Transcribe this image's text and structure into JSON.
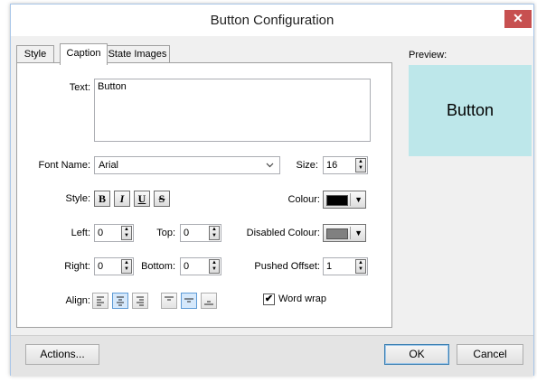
{
  "window": {
    "title": "Button Configuration",
    "close_glyph": "✕"
  },
  "tabs": [
    {
      "label": "Style",
      "active": false
    },
    {
      "label": "Caption",
      "active": true
    },
    {
      "label": "State Images",
      "active": false
    }
  ],
  "caption": {
    "text_label": "Text:",
    "text_value": "Button",
    "font_name_label": "Font Name:",
    "font_name_value": "Arial",
    "size_label": "Size:",
    "size_value": "16",
    "style_label": "Style:",
    "style_buttons": [
      "B",
      "I",
      "U",
      "S"
    ],
    "colour_label": "Colour:",
    "colour_value": "#000000",
    "disabled_colour_label": "Disabled Colour:",
    "disabled_colour_value": "#808080",
    "left_label": "Left:",
    "left_value": "0",
    "top_label": "Top:",
    "top_value": "0",
    "right_label": "Right:",
    "right_value": "0",
    "bottom_label": "Bottom:",
    "bottom_value": "0",
    "pushed_offset_label": "Pushed Offset:",
    "pushed_offset_value": "1",
    "align_label": "Align:",
    "horizontal_align_selected": "center",
    "vertical_align_selected": "middle",
    "word_wrap_label": "Word wrap",
    "word_wrap_checked": true
  },
  "preview": {
    "label": "Preview:",
    "button_text": "Button",
    "background": "#bde7ea"
  },
  "footer": {
    "actions_label": "Actions...",
    "ok_label": "OK",
    "cancel_label": "Cancel"
  }
}
